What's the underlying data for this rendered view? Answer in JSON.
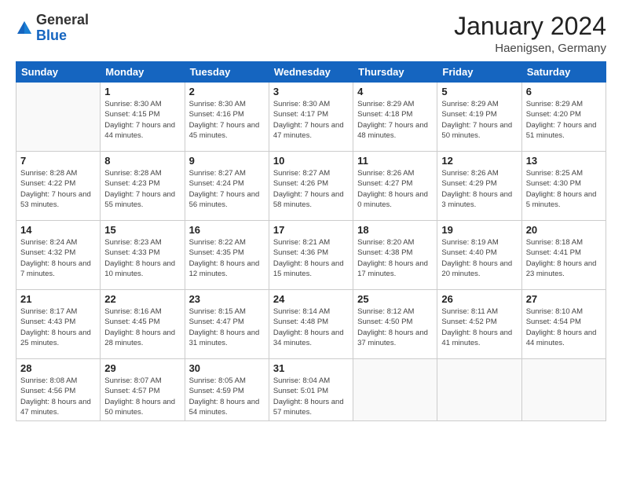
{
  "header": {
    "logo": {
      "general": "General",
      "blue": "Blue"
    },
    "title": "January 2024",
    "location": "Haenigsen, Germany"
  },
  "weekdays": [
    "Sunday",
    "Monday",
    "Tuesday",
    "Wednesday",
    "Thursday",
    "Friday",
    "Saturday"
  ],
  "weeks": [
    [
      null,
      {
        "day": "1",
        "sunrise": "Sunrise: 8:30 AM",
        "sunset": "Sunset: 4:15 PM",
        "daylight": "Daylight: 7 hours and 44 minutes."
      },
      {
        "day": "2",
        "sunrise": "Sunrise: 8:30 AM",
        "sunset": "Sunset: 4:16 PM",
        "daylight": "Daylight: 7 hours and 45 minutes."
      },
      {
        "day": "3",
        "sunrise": "Sunrise: 8:30 AM",
        "sunset": "Sunset: 4:17 PM",
        "daylight": "Daylight: 7 hours and 47 minutes."
      },
      {
        "day": "4",
        "sunrise": "Sunrise: 8:29 AM",
        "sunset": "Sunset: 4:18 PM",
        "daylight": "Daylight: 7 hours and 48 minutes."
      },
      {
        "day": "5",
        "sunrise": "Sunrise: 8:29 AM",
        "sunset": "Sunset: 4:19 PM",
        "daylight": "Daylight: 7 hours and 50 minutes."
      },
      {
        "day": "6",
        "sunrise": "Sunrise: 8:29 AM",
        "sunset": "Sunset: 4:20 PM",
        "daylight": "Daylight: 7 hours and 51 minutes."
      }
    ],
    [
      {
        "day": "7",
        "sunrise": "Sunrise: 8:28 AM",
        "sunset": "Sunset: 4:22 PM",
        "daylight": "Daylight: 7 hours and 53 minutes."
      },
      {
        "day": "8",
        "sunrise": "Sunrise: 8:28 AM",
        "sunset": "Sunset: 4:23 PM",
        "daylight": "Daylight: 7 hours and 55 minutes."
      },
      {
        "day": "9",
        "sunrise": "Sunrise: 8:27 AM",
        "sunset": "Sunset: 4:24 PM",
        "daylight": "Daylight: 7 hours and 56 minutes."
      },
      {
        "day": "10",
        "sunrise": "Sunrise: 8:27 AM",
        "sunset": "Sunset: 4:26 PM",
        "daylight": "Daylight: 7 hours and 58 minutes."
      },
      {
        "day": "11",
        "sunrise": "Sunrise: 8:26 AM",
        "sunset": "Sunset: 4:27 PM",
        "daylight": "Daylight: 8 hours and 0 minutes."
      },
      {
        "day": "12",
        "sunrise": "Sunrise: 8:26 AM",
        "sunset": "Sunset: 4:29 PM",
        "daylight": "Daylight: 8 hours and 3 minutes."
      },
      {
        "day": "13",
        "sunrise": "Sunrise: 8:25 AM",
        "sunset": "Sunset: 4:30 PM",
        "daylight": "Daylight: 8 hours and 5 minutes."
      }
    ],
    [
      {
        "day": "14",
        "sunrise": "Sunrise: 8:24 AM",
        "sunset": "Sunset: 4:32 PM",
        "daylight": "Daylight: 8 hours and 7 minutes."
      },
      {
        "day": "15",
        "sunrise": "Sunrise: 8:23 AM",
        "sunset": "Sunset: 4:33 PM",
        "daylight": "Daylight: 8 hours and 10 minutes."
      },
      {
        "day": "16",
        "sunrise": "Sunrise: 8:22 AM",
        "sunset": "Sunset: 4:35 PM",
        "daylight": "Daylight: 8 hours and 12 minutes."
      },
      {
        "day": "17",
        "sunrise": "Sunrise: 8:21 AM",
        "sunset": "Sunset: 4:36 PM",
        "daylight": "Daylight: 8 hours and 15 minutes."
      },
      {
        "day": "18",
        "sunrise": "Sunrise: 8:20 AM",
        "sunset": "Sunset: 4:38 PM",
        "daylight": "Daylight: 8 hours and 17 minutes."
      },
      {
        "day": "19",
        "sunrise": "Sunrise: 8:19 AM",
        "sunset": "Sunset: 4:40 PM",
        "daylight": "Daylight: 8 hours and 20 minutes."
      },
      {
        "day": "20",
        "sunrise": "Sunrise: 8:18 AM",
        "sunset": "Sunset: 4:41 PM",
        "daylight": "Daylight: 8 hours and 23 minutes."
      }
    ],
    [
      {
        "day": "21",
        "sunrise": "Sunrise: 8:17 AM",
        "sunset": "Sunset: 4:43 PM",
        "daylight": "Daylight: 8 hours and 25 minutes."
      },
      {
        "day": "22",
        "sunrise": "Sunrise: 8:16 AM",
        "sunset": "Sunset: 4:45 PM",
        "daylight": "Daylight: 8 hours and 28 minutes."
      },
      {
        "day": "23",
        "sunrise": "Sunrise: 8:15 AM",
        "sunset": "Sunset: 4:47 PM",
        "daylight": "Daylight: 8 hours and 31 minutes."
      },
      {
        "day": "24",
        "sunrise": "Sunrise: 8:14 AM",
        "sunset": "Sunset: 4:48 PM",
        "daylight": "Daylight: 8 hours and 34 minutes."
      },
      {
        "day": "25",
        "sunrise": "Sunrise: 8:12 AM",
        "sunset": "Sunset: 4:50 PM",
        "daylight": "Daylight: 8 hours and 37 minutes."
      },
      {
        "day": "26",
        "sunrise": "Sunrise: 8:11 AM",
        "sunset": "Sunset: 4:52 PM",
        "daylight": "Daylight: 8 hours and 41 minutes."
      },
      {
        "day": "27",
        "sunrise": "Sunrise: 8:10 AM",
        "sunset": "Sunset: 4:54 PM",
        "daylight": "Daylight: 8 hours and 44 minutes."
      }
    ],
    [
      {
        "day": "28",
        "sunrise": "Sunrise: 8:08 AM",
        "sunset": "Sunset: 4:56 PM",
        "daylight": "Daylight: 8 hours and 47 minutes."
      },
      {
        "day": "29",
        "sunrise": "Sunrise: 8:07 AM",
        "sunset": "Sunset: 4:57 PM",
        "daylight": "Daylight: 8 hours and 50 minutes."
      },
      {
        "day": "30",
        "sunrise": "Sunrise: 8:05 AM",
        "sunset": "Sunset: 4:59 PM",
        "daylight": "Daylight: 8 hours and 54 minutes."
      },
      {
        "day": "31",
        "sunrise": "Sunrise: 8:04 AM",
        "sunset": "Sunset: 5:01 PM",
        "daylight": "Daylight: 8 hours and 57 minutes."
      },
      null,
      null,
      null
    ]
  ]
}
